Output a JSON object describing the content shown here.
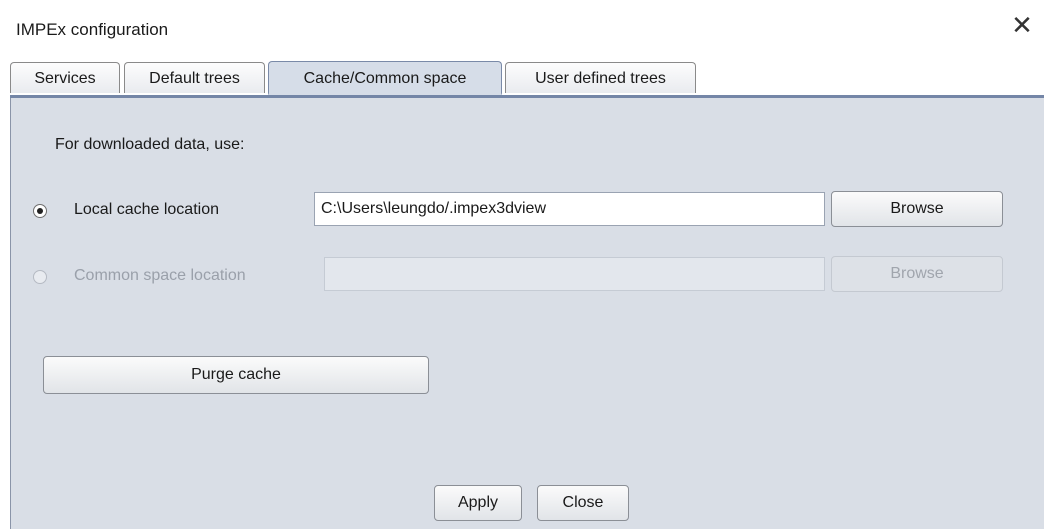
{
  "window": {
    "title": "IMPEx configuration",
    "close_glyph": "✕"
  },
  "tabs": [
    {
      "label": "Services",
      "active": false
    },
    {
      "label": "Default trees",
      "active": false
    },
    {
      "label": "Cache/Common space",
      "active": true
    },
    {
      "label": "User defined trees",
      "active": false
    }
  ],
  "panel": {
    "intro_label": "For downloaded data, use:",
    "local_cache": {
      "label": "Local cache location",
      "selected": true,
      "value": "C:\\Users\\leungdo/.impex3dview",
      "browse_label": "Browse"
    },
    "common_space": {
      "label": "Common space location",
      "selected": false,
      "enabled": false,
      "value": "",
      "browse_label": "Browse"
    },
    "purge_label": "Purge cache"
  },
  "footer": {
    "apply_label": "Apply",
    "close_label": "Close"
  },
  "colors": {
    "panel_bg": "#d9dee6",
    "active_tab_bg": "#d6dde8",
    "tab_separator": "#7486a7"
  }
}
